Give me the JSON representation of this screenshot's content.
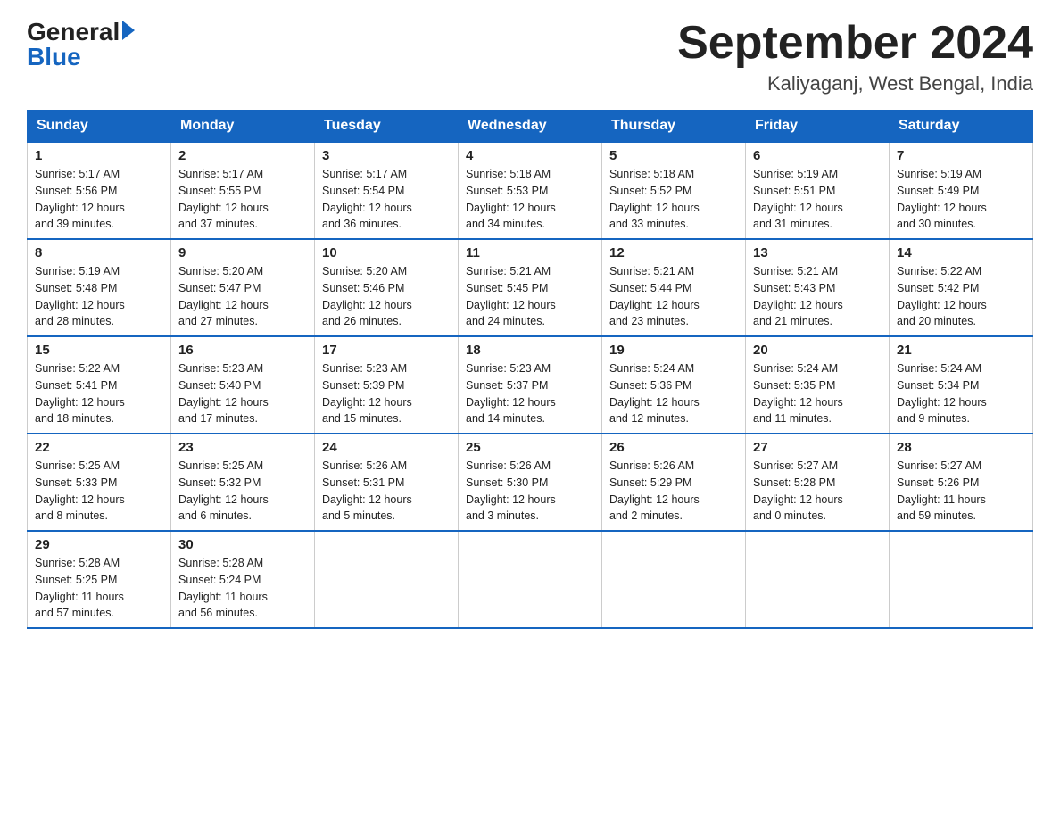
{
  "logo": {
    "general": "General",
    "blue": "Blue"
  },
  "title": {
    "month": "September 2024",
    "location": "Kaliyaganj, West Bengal, India"
  },
  "days_of_week": [
    "Sunday",
    "Monday",
    "Tuesday",
    "Wednesday",
    "Thursday",
    "Friday",
    "Saturday"
  ],
  "weeks": [
    [
      {
        "day": "1",
        "sunrise": "5:17 AM",
        "sunset": "5:56 PM",
        "daylight": "12 hours and 39 minutes."
      },
      {
        "day": "2",
        "sunrise": "5:17 AM",
        "sunset": "5:55 PM",
        "daylight": "12 hours and 37 minutes."
      },
      {
        "day": "3",
        "sunrise": "5:17 AM",
        "sunset": "5:54 PM",
        "daylight": "12 hours and 36 minutes."
      },
      {
        "day": "4",
        "sunrise": "5:18 AM",
        "sunset": "5:53 PM",
        "daylight": "12 hours and 34 minutes."
      },
      {
        "day": "5",
        "sunrise": "5:18 AM",
        "sunset": "5:52 PM",
        "daylight": "12 hours and 33 minutes."
      },
      {
        "day": "6",
        "sunrise": "5:19 AM",
        "sunset": "5:51 PM",
        "daylight": "12 hours and 31 minutes."
      },
      {
        "day": "7",
        "sunrise": "5:19 AM",
        "sunset": "5:49 PM",
        "daylight": "12 hours and 30 minutes."
      }
    ],
    [
      {
        "day": "8",
        "sunrise": "5:19 AM",
        "sunset": "5:48 PM",
        "daylight": "12 hours and 28 minutes."
      },
      {
        "day": "9",
        "sunrise": "5:20 AM",
        "sunset": "5:47 PM",
        "daylight": "12 hours and 27 minutes."
      },
      {
        "day": "10",
        "sunrise": "5:20 AM",
        "sunset": "5:46 PM",
        "daylight": "12 hours and 26 minutes."
      },
      {
        "day": "11",
        "sunrise": "5:21 AM",
        "sunset": "5:45 PM",
        "daylight": "12 hours and 24 minutes."
      },
      {
        "day": "12",
        "sunrise": "5:21 AM",
        "sunset": "5:44 PM",
        "daylight": "12 hours and 23 minutes."
      },
      {
        "day": "13",
        "sunrise": "5:21 AM",
        "sunset": "5:43 PM",
        "daylight": "12 hours and 21 minutes."
      },
      {
        "day": "14",
        "sunrise": "5:22 AM",
        "sunset": "5:42 PM",
        "daylight": "12 hours and 20 minutes."
      }
    ],
    [
      {
        "day": "15",
        "sunrise": "5:22 AM",
        "sunset": "5:41 PM",
        "daylight": "12 hours and 18 minutes."
      },
      {
        "day": "16",
        "sunrise": "5:23 AM",
        "sunset": "5:40 PM",
        "daylight": "12 hours and 17 minutes."
      },
      {
        "day": "17",
        "sunrise": "5:23 AM",
        "sunset": "5:39 PM",
        "daylight": "12 hours and 15 minutes."
      },
      {
        "day": "18",
        "sunrise": "5:23 AM",
        "sunset": "5:37 PM",
        "daylight": "12 hours and 14 minutes."
      },
      {
        "day": "19",
        "sunrise": "5:24 AM",
        "sunset": "5:36 PM",
        "daylight": "12 hours and 12 minutes."
      },
      {
        "day": "20",
        "sunrise": "5:24 AM",
        "sunset": "5:35 PM",
        "daylight": "12 hours and 11 minutes."
      },
      {
        "day": "21",
        "sunrise": "5:24 AM",
        "sunset": "5:34 PM",
        "daylight": "12 hours and 9 minutes."
      }
    ],
    [
      {
        "day": "22",
        "sunrise": "5:25 AM",
        "sunset": "5:33 PM",
        "daylight": "12 hours and 8 minutes."
      },
      {
        "day": "23",
        "sunrise": "5:25 AM",
        "sunset": "5:32 PM",
        "daylight": "12 hours and 6 minutes."
      },
      {
        "day": "24",
        "sunrise": "5:26 AM",
        "sunset": "5:31 PM",
        "daylight": "12 hours and 5 minutes."
      },
      {
        "day": "25",
        "sunrise": "5:26 AM",
        "sunset": "5:30 PM",
        "daylight": "12 hours and 3 minutes."
      },
      {
        "day": "26",
        "sunrise": "5:26 AM",
        "sunset": "5:29 PM",
        "daylight": "12 hours and 2 minutes."
      },
      {
        "day": "27",
        "sunrise": "5:27 AM",
        "sunset": "5:28 PM",
        "daylight": "12 hours and 0 minutes."
      },
      {
        "day": "28",
        "sunrise": "5:27 AM",
        "sunset": "5:26 PM",
        "daylight": "11 hours and 59 minutes."
      }
    ],
    [
      {
        "day": "29",
        "sunrise": "5:28 AM",
        "sunset": "5:25 PM",
        "daylight": "11 hours and 57 minutes."
      },
      {
        "day": "30",
        "sunrise": "5:28 AM",
        "sunset": "5:24 PM",
        "daylight": "11 hours and 56 minutes."
      },
      null,
      null,
      null,
      null,
      null
    ]
  ],
  "labels": {
    "sunrise": "Sunrise:",
    "sunset": "Sunset:",
    "daylight": "Daylight:"
  }
}
